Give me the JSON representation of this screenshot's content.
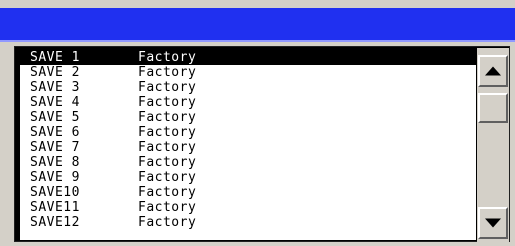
{
  "title_bar": {
    "color": "#2030f0"
  },
  "save_list": {
    "selected_index": 0,
    "items": [
      {
        "name": "SAVE 1",
        "value": "Factory"
      },
      {
        "name": "SAVE 2",
        "value": "Factory"
      },
      {
        "name": "SAVE 3",
        "value": "Factory"
      },
      {
        "name": "SAVE 4",
        "value": "Factory"
      },
      {
        "name": "SAVE 5",
        "value": "Factory"
      },
      {
        "name": "SAVE 6",
        "value": "Factory"
      },
      {
        "name": "SAVE 7",
        "value": "Factory"
      },
      {
        "name": "SAVE 8",
        "value": "Factory"
      },
      {
        "name": "SAVE 9",
        "value": "Factory"
      },
      {
        "name": "SAVE10",
        "value": "Factory"
      },
      {
        "name": "SAVE11",
        "value": "Factory"
      },
      {
        "name": "SAVE12",
        "value": "Factory"
      }
    ]
  },
  "scrollbar": {
    "up_icon": "triangle-up-icon",
    "down_icon": "triangle-down-icon"
  }
}
